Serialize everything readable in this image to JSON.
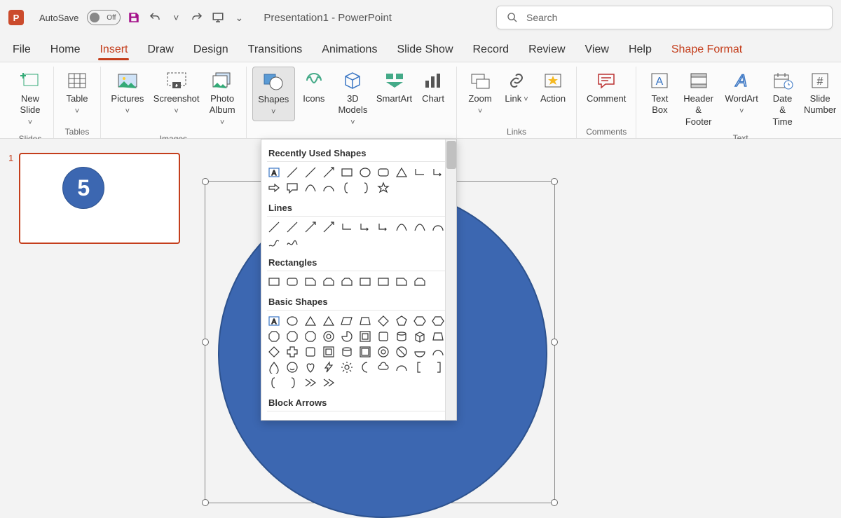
{
  "app": {
    "letter": "P",
    "autosave_label": "AutoSave",
    "toggle_state": "Off",
    "doc_title": "Presentation1  -  PowerPoint"
  },
  "search": {
    "placeholder": "Search"
  },
  "tabs": {
    "file": "File",
    "home": "Home",
    "insert": "Insert",
    "draw": "Draw",
    "design": "Design",
    "transitions": "Transitions",
    "animations": "Animations",
    "slideshow": "Slide Show",
    "record": "Record",
    "review": "Review",
    "view": "View",
    "help": "Help",
    "shapefmt": "Shape Format"
  },
  "ribbon": {
    "new_slide": "New\nSlide",
    "table": "Table",
    "pictures": "Pictures",
    "screenshot": "Screenshot",
    "photo_album": "Photo\nAlbum",
    "shapes": "Shapes",
    "icons": "Icons",
    "models": "3D\nModels",
    "smartart": "SmartArt",
    "chart": "Chart",
    "zoom": "Zoom",
    "link": "Link",
    "action": "Action",
    "comment": "Comment",
    "textbox": "Text\nBox",
    "headerfooter": "Header\n& Footer",
    "wordart": "WordArt",
    "datetime": "Date &\nTime",
    "slidenum": "Slide\nNumber",
    "grp_slides": "Slides",
    "grp_tables": "Tables",
    "grp_images": "Images",
    "grp_links": "Links",
    "grp_comments": "Comments",
    "grp_text": "Text"
  },
  "shapes_panel": {
    "recently": "Recently Used Shapes",
    "lines": "Lines",
    "rectangles": "Rectangles",
    "basic": "Basic Shapes",
    "block": "Block Arrows"
  },
  "slide": {
    "number": "1",
    "value": "5"
  }
}
